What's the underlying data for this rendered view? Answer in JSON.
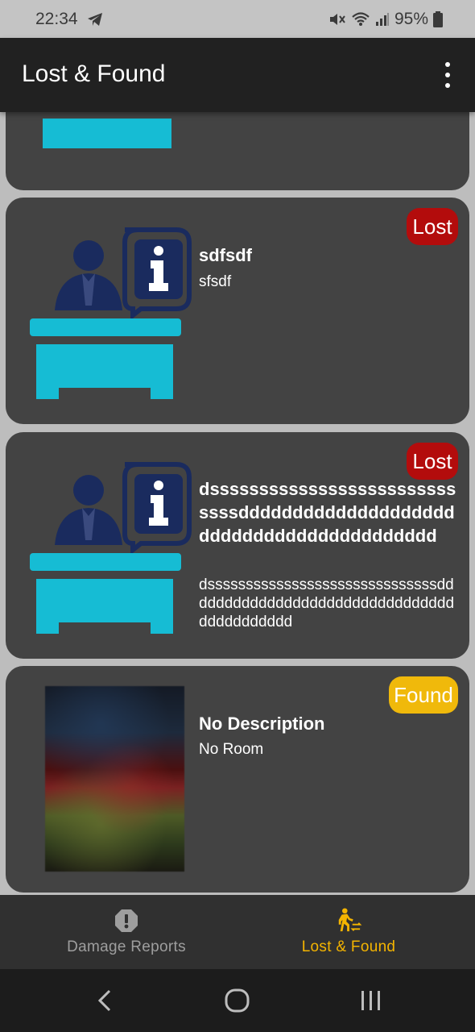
{
  "status_bar": {
    "time": "22:34",
    "battery": "95%"
  },
  "app_bar": {
    "title": "Lost & Found"
  },
  "items": [
    {
      "title": "sdfsdf",
      "subtitle": "sfsdf",
      "status": "Lost",
      "image": "reception-desk-icon"
    },
    {
      "title": "dsssssssssssssssssssssssssssssdddddddddddddddddddddddddddddddddddddddddd",
      "subtitle": "dssssssssssssssssssssssssssssssddddddddddddddddddddddddddddddddddddddddddd",
      "status": "Lost",
      "image": "reception-desk-icon"
    },
    {
      "title": "No Description",
      "subtitle": "No Room",
      "status": "Found",
      "image": "photo"
    }
  ],
  "bottom_nav": {
    "damage_label": "Damage Reports",
    "lost_label": "Lost & Found"
  },
  "colors": {
    "lost": "#b30c0c",
    "found": "#f0b90b",
    "active": "#f4b400",
    "card": "#434343",
    "desk": "#16bcd4",
    "navy": "#1a2b5e"
  }
}
